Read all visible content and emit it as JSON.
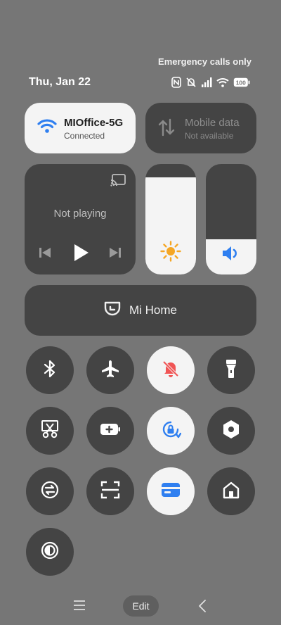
{
  "status": {
    "carrier": "Emergency calls only",
    "date": "Thu, Jan 22",
    "battery": "100"
  },
  "wifi_tile": {
    "title": "MIOffice-5G",
    "subtitle": "Connected",
    "icon": "wifi-icon"
  },
  "mobile_tile": {
    "title": "Mobile data",
    "subtitle": "Not available",
    "icon": "mobile-data-icon"
  },
  "media": {
    "status": "Not playing"
  },
  "brightness": {
    "level": 0.88
  },
  "volume": {
    "level": 0.32
  },
  "mi_home": {
    "label": "Mi Home"
  },
  "toggles": [
    {
      "name": "bluetooth",
      "on": false
    },
    {
      "name": "airplane-mode",
      "on": false
    },
    {
      "name": "mute",
      "on": true
    },
    {
      "name": "flashlight",
      "on": false
    },
    {
      "name": "screenshot",
      "on": false
    },
    {
      "name": "battery-saver",
      "on": false
    },
    {
      "name": "rotation-lock",
      "on": true
    },
    {
      "name": "settings",
      "on": false
    },
    {
      "name": "sync",
      "on": false
    },
    {
      "name": "scanner",
      "on": false
    },
    {
      "name": "wallet",
      "on": true
    },
    {
      "name": "home",
      "on": false
    },
    {
      "name": "dark-mode",
      "on": false
    }
  ],
  "colors": {
    "accent": "#2f7ff0",
    "mute_red": "#f05454",
    "sun": "#f5a623"
  },
  "navbar": {
    "edit_label": "Edit"
  }
}
